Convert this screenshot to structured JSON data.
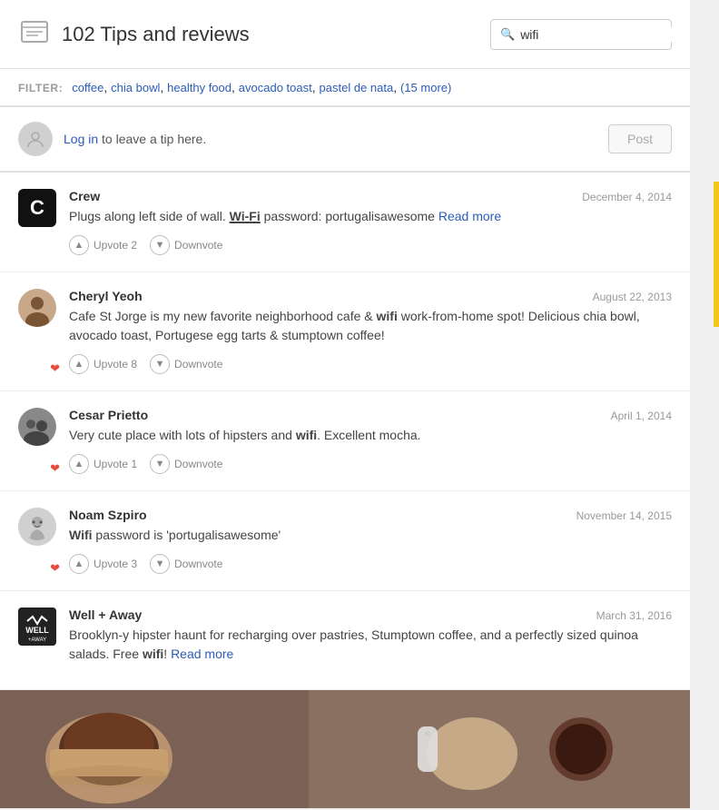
{
  "header": {
    "title": "102 Tips and reviews",
    "search_value": "wifi",
    "search_placeholder": "wifi"
  },
  "filter": {
    "label": "FILTER:",
    "items": [
      "coffee",
      "chia bowl",
      "healthy food",
      "avocado toast",
      "pastel de nata",
      "(15 more)"
    ]
  },
  "login": {
    "text_before": "",
    "link_text": "Log in",
    "text_after": " to leave a tip here.",
    "post_label": "Post"
  },
  "tips": [
    {
      "author": "Crew",
      "date": "December 4, 2014",
      "avatar_type": "black_letter",
      "avatar_letter": "C",
      "has_heart": false,
      "text_parts": [
        {
          "type": "plain",
          "text": "Plugs along left side of wall. "
        },
        {
          "type": "wifi_highlight",
          "text": "Wi-Fi"
        },
        {
          "type": "plain",
          "text": " password: portugalisawesome "
        },
        {
          "type": "read_more",
          "text": "Read more"
        }
      ],
      "vote_up_label": "Upvote",
      "vote_up_count": "2",
      "vote_down_label": "Downvote"
    },
    {
      "author": "Cheryl Yeoh",
      "date": "August 22, 2013",
      "avatar_type": "photo_female",
      "has_heart": true,
      "text_parts": [
        {
          "type": "plain",
          "text": "Cafe St Jorge is my new favorite neighborhood cafe & "
        },
        {
          "type": "bold",
          "text": "wifi"
        },
        {
          "type": "plain",
          "text": " work-from-home spot! Delicious chia bowl, avocado toast, Portugese egg tarts & stumptown coffee!"
        }
      ],
      "vote_up_label": "Upvote",
      "vote_up_count": "8",
      "vote_down_label": "Downvote"
    },
    {
      "author": "Cesar Prietto",
      "date": "April 1, 2014",
      "avatar_type": "photo_group",
      "has_heart": true,
      "text_parts": [
        {
          "type": "plain",
          "text": "Very cute place with lots of hipsters and "
        },
        {
          "type": "bold",
          "text": "wifi"
        },
        {
          "type": "plain",
          "text": ". Excellent mocha."
        }
      ],
      "vote_up_label": "Upvote",
      "vote_up_count": "1",
      "vote_down_label": "Downvote"
    },
    {
      "author": "Noam Szpiro",
      "date": "November 14, 2015",
      "avatar_type": "photo_cartoon",
      "has_heart": true,
      "text_parts": [
        {
          "type": "bold",
          "text": "Wifi"
        },
        {
          "type": "plain",
          "text": " password is 'portugalisawesome'"
        }
      ],
      "vote_up_label": "Upvote",
      "vote_up_count": "3",
      "vote_down_label": "Downvote"
    },
    {
      "author": "Well + Away",
      "date": "March 31, 2016",
      "avatar_type": "logo",
      "has_heart": false,
      "text_parts": [
        {
          "type": "plain",
          "text": "Brooklyn-y hipster haunt for recharging over pastries, Stumptown coffee, and a perfectly sized quinoa salads. Free "
        },
        {
          "type": "bold",
          "text": "wifi"
        },
        {
          "type": "plain",
          "text": "! "
        },
        {
          "type": "read_more",
          "text": "Read more"
        }
      ],
      "vote_up_label": "Upvote",
      "vote_up_count": "",
      "vote_down_label": "Downvote",
      "has_photo": true
    }
  ]
}
